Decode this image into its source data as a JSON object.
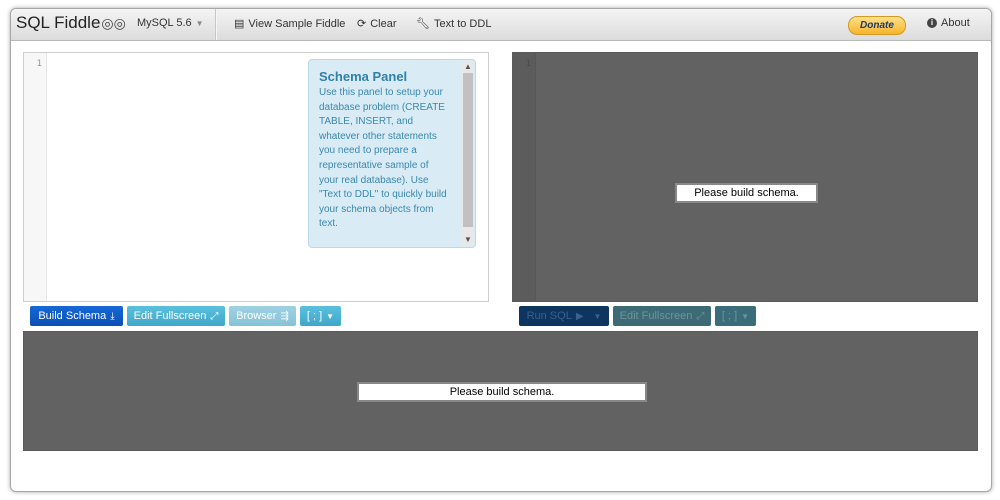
{
  "app": {
    "brand": "SQL Fiddle",
    "db_selector": "MySQL 5.6",
    "nav": {
      "view_sample": "View Sample Fiddle",
      "clear": "Clear",
      "text_to_ddl": "Text to DDL"
    },
    "donate": "Donate",
    "about": "About"
  },
  "schema_panel": {
    "line_number": "1",
    "help_title": "Schema Panel",
    "help_text": "Use this panel to setup your database problem (CREATE TABLE, INSERT, and whatever other statements you need to prepare a representative sample of your real database). Use \"Text to DDL\" to quickly build your schema objects from text.",
    "buttons": {
      "build_schema": "Build Schema",
      "edit_fullscreen": "Edit Fullscreen",
      "browser": "Browser",
      "terminator": "[ ; ]"
    }
  },
  "query_panel": {
    "line_number": "1",
    "message": "Please build schema.",
    "buttons": {
      "run_sql": "Run SQL",
      "edit_fullscreen": "Edit Fullscreen",
      "terminator": "[ ; ]"
    }
  },
  "results_panel": {
    "message": "Please build schema."
  },
  "icons": [
    "logo-icon",
    "caret-down-icon",
    "list-icon",
    "refresh-icon",
    "wrench-icon",
    "info-icon",
    "download-icon",
    "expand-icon",
    "browser-icon",
    "play-icon",
    "scroll-up-icon",
    "scroll-down-icon"
  ],
  "colors": {
    "primary_button": "#0a4fb4",
    "info_button": "#5bc0de",
    "dark_panel": "#626262",
    "help_background": "#d9ecf5",
    "help_text": "#3a87ad"
  }
}
